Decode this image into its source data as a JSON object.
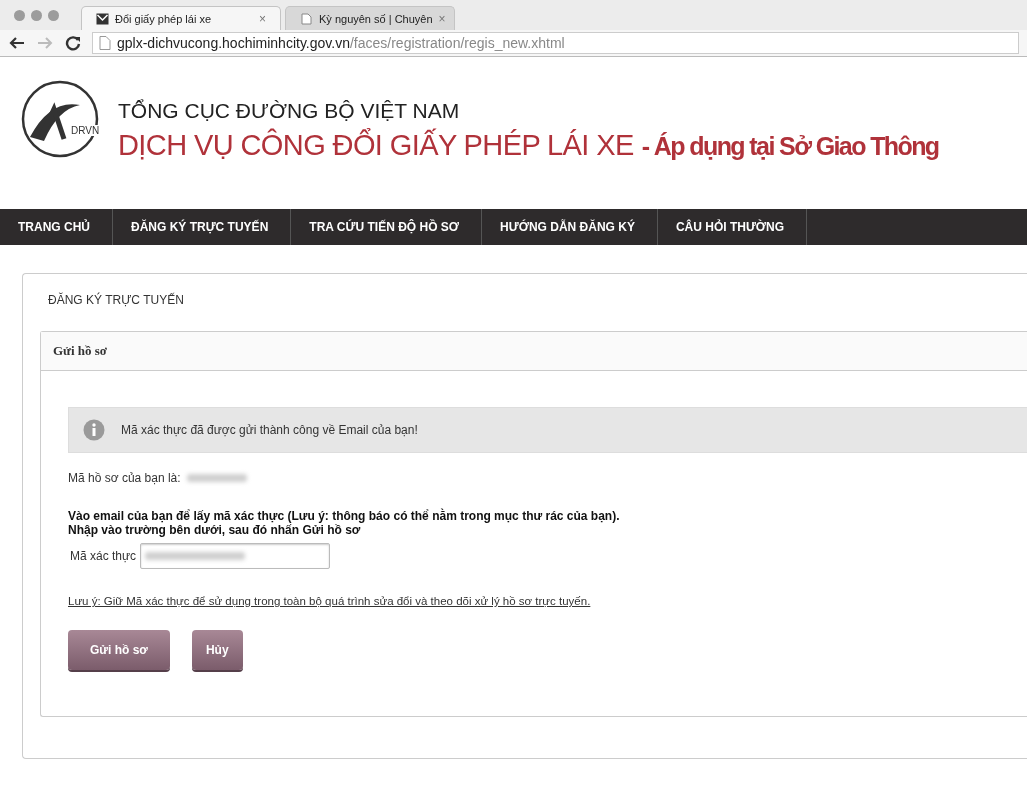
{
  "browser": {
    "tabs": [
      {
        "title": "Đổi giấy phép lái xe",
        "close": "×",
        "selected": true
      },
      {
        "title": "Kỳ nguyên số | Chuyên",
        "close": "×",
        "selected": false
      }
    ],
    "url_host": "gplx-dichvucong.hochiminhcity.gov.vn",
    "url_path": "/faces/registration/regis_new.xhtml"
  },
  "header": {
    "logo_text": "DRVN",
    "org_title": "TỔNG CỤC ĐƯỜNG BỘ VIỆT NAM",
    "service_title": "DỊCH VỤ CÔNG ĐỔI GIẤY PHÉP LÁI XE",
    "service_subtitle": "- Áp dụng tại Sở Giao Thông"
  },
  "nav": [
    {
      "label": "TRANG CHỦ",
      "selected": false
    },
    {
      "label": "ĐĂNG KÝ TRỰC TUYẾN",
      "selected": false
    },
    {
      "label": "TRA CỨU TIẾN ĐỘ HỒ SƠ",
      "selected": false
    },
    {
      "label": "HƯỚNG DẪN ĐĂNG KÝ",
      "selected": false
    },
    {
      "label": "CÂU HỎI THƯỜNG",
      "selected": false
    }
  ],
  "page": {
    "breadcrumb": "ĐĂNG KÝ TRỰC TUYẾN",
    "panel": {
      "title": "Gửi hồ sơ",
      "info_message": "Mã xác thực đã được gửi thành công về Email của bạn!",
      "record_label": "Mã hồ sơ của bạn là:",
      "instruction_lines": [
        "Vào email của bạn để lấy mã xác thực (Lưu ý: thông báo có thể nằm trong mục thư rác của bạn).",
        "Nhập vào trường bên dưới, sau đó nhấn Gửi hồ sơ"
      ],
      "code_label": "Mã xác thực",
      "note_link": "Lưu ý: Giữ Mã xác thực để sử dụng trong toàn bộ quá trình sửa đổi và theo dõi xử lý hồ sơ trực tuyến.",
      "buttons": [
        "Gửi hồ sơ",
        "Hủy"
      ]
    }
  }
}
